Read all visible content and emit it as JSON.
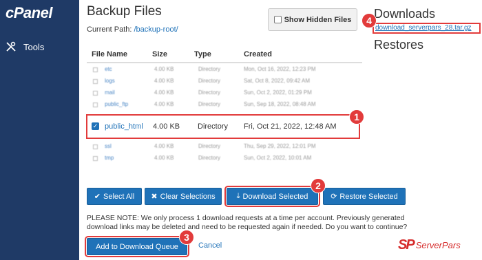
{
  "brand": "cPanel",
  "sidebar": {
    "items": [
      {
        "label": "Tools",
        "icon": "tools-icon"
      }
    ]
  },
  "page": {
    "title": "Backup Files",
    "path_label": "Current Path:",
    "path_value": "/backup-root/",
    "show_hidden_label": "Show Hidden Files"
  },
  "table": {
    "headers": [
      "File Name",
      "Size",
      "Type",
      "Created"
    ],
    "rows_top": [
      {
        "name": "etc",
        "size": "4.00 KB",
        "type": "Directory",
        "created": "Mon, Oct 16, 2022, 12:23 PM"
      },
      {
        "name": "logs",
        "size": "4.00 KB",
        "type": "Directory",
        "created": "Sat, Oct 8, 2022, 09:42 AM"
      },
      {
        "name": "mail",
        "size": "4.00 KB",
        "type": "Directory",
        "created": "Sun, Oct 2, 2022, 01:29 PM"
      },
      {
        "name": "public_ftp",
        "size": "4.00 KB",
        "type": "Directory",
        "created": "Sun, Sep 18, 2022, 08:48 AM"
      }
    ],
    "selected_row": {
      "name": "public_html",
      "size": "4.00 KB",
      "type": "Directory",
      "created": "Fri, Oct 21, 2022, 12:48 AM",
      "checked": true
    },
    "rows_bottom": [
      {
        "name": "ssl",
        "size": "4.00 KB",
        "type": "Directory",
        "created": "Thu, Sep 29, 2022, 12:01 PM"
      },
      {
        "name": "tmp",
        "size": "4.00 KB",
        "type": "Directory",
        "created": "Sun, Oct 2, 2022, 10:01 AM"
      }
    ]
  },
  "buttons": {
    "select_all": "Select All",
    "clear_selections": "Clear Selections",
    "download_selected": "Download Selected",
    "restore_selected": "Restore Selected"
  },
  "note": "PLEASE NOTE: We only process 1 download requests at a time per account. Previously generated download links may be deleted and need to be requested again if needed. Do you want to continue?",
  "queue_button": "Add to Download Queue",
  "cancel": "Cancel",
  "downloads": {
    "title": "Downloads",
    "file": "download_serverpars_28.tar.gz"
  },
  "restores": {
    "title": "Restores"
  },
  "badges": [
    "1",
    "2",
    "3",
    "4"
  ],
  "watermark": {
    "mark": "SP",
    "text": "ServerPars"
  },
  "colors": {
    "sidebar": "#1f3a66",
    "primary": "#1f72b8",
    "highlight": "#e23b3b"
  }
}
